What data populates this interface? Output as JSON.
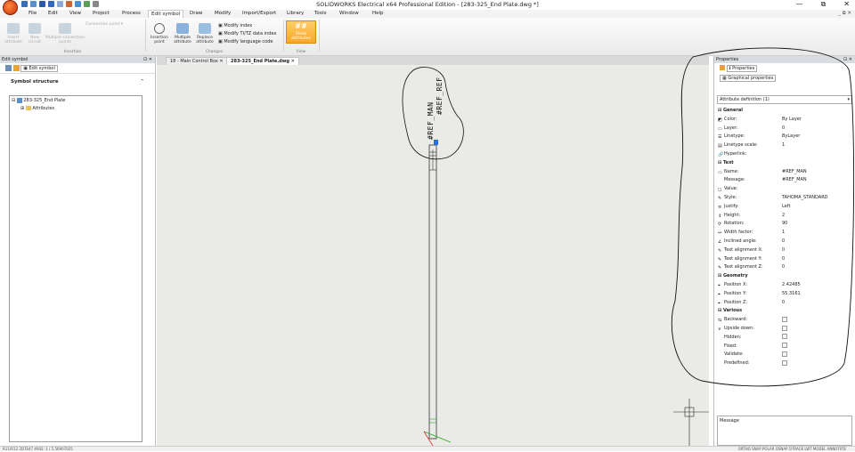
{
  "window": {
    "title": "SOLIDWORKS Electrical x64 Professional Edition - [283-325_End Plate.dwg *]",
    "min": "—",
    "max": "⧉",
    "close": "✕",
    "mdi_controls": "_ ⧉ ✕"
  },
  "menu": [
    "File",
    "Edit",
    "View",
    "Project",
    "Process",
    "Edit symbol",
    "Draw",
    "Modify",
    "Import/Export",
    "Library",
    "Tools",
    "Window",
    "Help"
  ],
  "menu_active_index": 5,
  "ribbon": {
    "insertion_group": {
      "buttons": [
        "Insert attribute",
        "New circuit",
        "Multiple connection points"
      ],
      "connection_point": "Connection point",
      "label": "Insertion"
    },
    "changes_group": {
      "buttons": [
        "Insertion point",
        "Multiple attribute",
        "Replace attribute"
      ],
      "small": [
        "Modify index",
        "Modify TI/TZ data index",
        "Modify language code"
      ],
      "label": "Changes"
    },
    "view_group": {
      "button_symbol": "##",
      "button": "Show attributes",
      "label": "View"
    }
  },
  "left_panel": {
    "header": "Edit symbol",
    "pin": "⊡ ✕",
    "tab": "Edit symbol",
    "section": "Symbol structure",
    "tree": {
      "root": "283-325_End Plate",
      "child": "Attributes"
    }
  },
  "doc_tabs": [
    "18 - Main Control Box",
    "283-325_End Plate.dwg"
  ],
  "doc_tab_close": "✕",
  "canvas": {
    "attribute_text": "#REF_MAN",
    "attribute_text2": "#REF_REF"
  },
  "right_panel": {
    "header": "Properties",
    "pin": "⊡ ✕",
    "tab1": "Properties",
    "tab2": "Graphical properties",
    "selector": "Attribute definition (1)",
    "rows": [
      {
        "section": "General"
      },
      {
        "label": "Color:",
        "value": "By Layer",
        "icon": "color-icon"
      },
      {
        "label": "Layer:",
        "value": "0",
        "icon": "layer-icon"
      },
      {
        "label": "Linetype:",
        "value": "ByLayer",
        "icon": "linetype-icon"
      },
      {
        "label": "Linetype scale:",
        "value": "1",
        "icon": "linetype-scale-icon"
      },
      {
        "label": "Hyperlink:",
        "value": "",
        "icon": "hyperlink-icon"
      },
      {
        "section": "Text"
      },
      {
        "label": "Name:",
        "value": "#REF_MAN",
        "icon": "name-icon"
      },
      {
        "label": "Message:",
        "value": "#REF_MAN",
        "icon": ""
      },
      {
        "label": "Value:",
        "value": "",
        "icon": "value-icon"
      },
      {
        "label": "Style:",
        "value": "TAHOMA_STANDARD",
        "icon": "style-icon"
      },
      {
        "label": "Justify:",
        "value": "Left",
        "icon": "justify-icon"
      },
      {
        "label": "Height:",
        "value": "2",
        "icon": "height-icon"
      },
      {
        "label": "Rotation:",
        "value": "90",
        "icon": "rotation-icon"
      },
      {
        "label": "Width factor:",
        "value": "1",
        "icon": "width-icon"
      },
      {
        "label": "Inclined angle:",
        "value": "0",
        "icon": "angle-icon"
      },
      {
        "label": "Text alignment X:",
        "value": "0",
        "icon": "align-icon"
      },
      {
        "label": "Text alignment Y:",
        "value": "0",
        "icon": "align-icon"
      },
      {
        "label": "Text alignment Z:",
        "value": "0",
        "icon": "align-icon"
      },
      {
        "section": "Geometry"
      },
      {
        "label": "Position X:",
        "value": "2.42485",
        "icon": "position-icon"
      },
      {
        "label": "Position Y:",
        "value": "55.3161",
        "icon": "position-icon"
      },
      {
        "label": "Position Z:",
        "value": "0",
        "icon": "position-icon"
      },
      {
        "section": "Various"
      },
      {
        "label": "Backward:",
        "check": true,
        "icon": "backward-icon"
      },
      {
        "label": "Upside down:",
        "check": true,
        "icon": "upside-icon"
      },
      {
        "label": "Hidden:",
        "check": true,
        "icon": ""
      },
      {
        "label": "Fixed:",
        "check": true,
        "icon": ""
      },
      {
        "label": "Validate:",
        "check": true,
        "icon": ""
      },
      {
        "label": "Predefined:",
        "check": true,
        "icon": ""
      }
    ],
    "message_label": "Message"
  },
  "status": {
    "left": "R11/R12 2D7E47 4942: 1 / 5.56907025",
    "right": "ORTHO SNAP POLAR OSNAP OTRACK LWT MODEL ANNOTATE"
  },
  "colors": {
    "ribbon_active_orange": "#f8a82a",
    "panel_header": "#d9dde2",
    "canvas_bg": "#eaeae6"
  }
}
